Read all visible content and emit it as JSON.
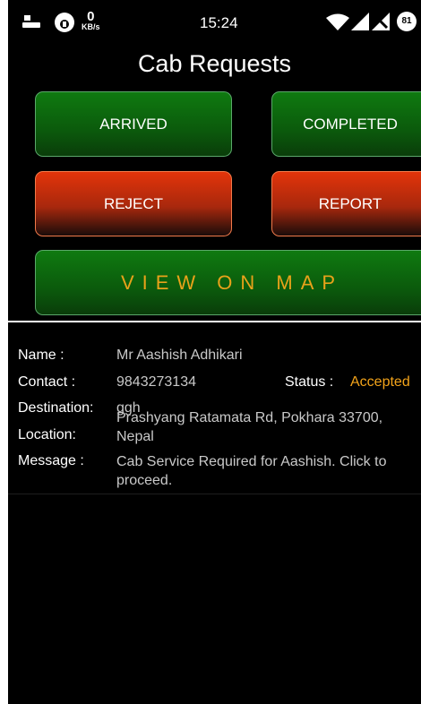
{
  "status_bar": {
    "speed_value": "0",
    "speed_unit": "KB/s",
    "time": "15:24",
    "battery": "81"
  },
  "header": {
    "title": "Cab Requests"
  },
  "actions": {
    "arrived": "ARRIVED",
    "completed": "COMPLETED",
    "reject": "REJECT",
    "report": "REPORT",
    "view_on_map": "VIEW ON MAP"
  },
  "details": {
    "name_label": "Name :",
    "name_value": "Mr  Aashish  Adhikari",
    "contact_label": "Contact :",
    "contact_value": "9843273134",
    "status_label": "Status :",
    "status_value": "Accepted",
    "destination_label": "Destination:",
    "destination_value": "ggh",
    "location_label": "Location:",
    "location_value": "Prashyang Ratamata Rd, Pokhara 33700, Nepal",
    "message_label": "Message :",
    "message_value": "Cab Service Required for Aashish. Click to proceed."
  },
  "colors": {
    "accent_status": "#f2a31a",
    "map_text": "#e8a21a",
    "green_button": "#0b5a0c",
    "red_button": "#a8280d"
  }
}
